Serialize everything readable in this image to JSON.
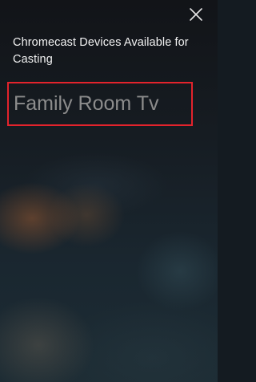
{
  "header": {
    "title": "Chromecast Devices Available for Casting",
    "close_icon": "close-icon"
  },
  "devices": [
    {
      "label": "Family Room Tv",
      "highlight_color": "#e3232c"
    }
  ],
  "colors": {
    "title_text": "#f2f2f2",
    "device_text": "#8c8c8c",
    "highlight": "#e3232c",
    "background": "#141b21"
  }
}
